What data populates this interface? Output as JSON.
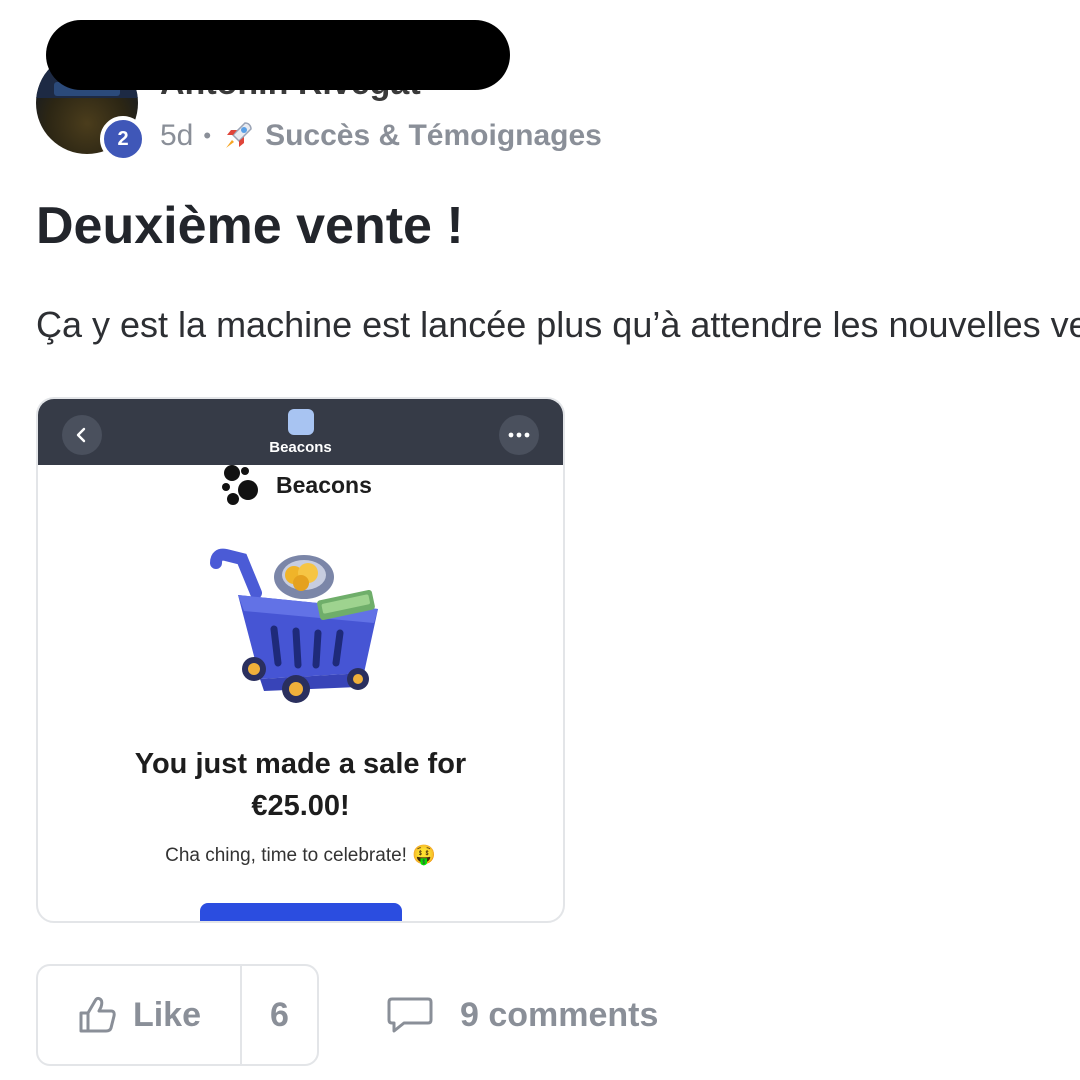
{
  "author": {
    "name": "Antonin Rivegat",
    "level": "2"
  },
  "meta": {
    "age": "5d",
    "separator": "•",
    "category_icon": "rocket-icon",
    "category": "Succès & Témoignages"
  },
  "post": {
    "title": "Deuxième vente !",
    "body": "Ça y est la machine est lancée plus qu’à attendre les nouvelles ventes"
  },
  "embed": {
    "header_title": "Beacons",
    "brand_name": "Beacons",
    "headline_line1": "You just made a sale for",
    "headline_line2": "€25.00!",
    "subtext": "Cha ching, time to celebrate! 🤑",
    "back_icon": "chevron-left-icon",
    "more_icon": "more-horizontal-icon",
    "accent": "#2b4de0",
    "header_bg": "#363b47"
  },
  "actions": {
    "like_label": "Like",
    "like_count": "6",
    "comments_label": "9 comments"
  },
  "colors": {
    "level_badge": "#3f57b8",
    "muted_text": "#8a8f98"
  }
}
